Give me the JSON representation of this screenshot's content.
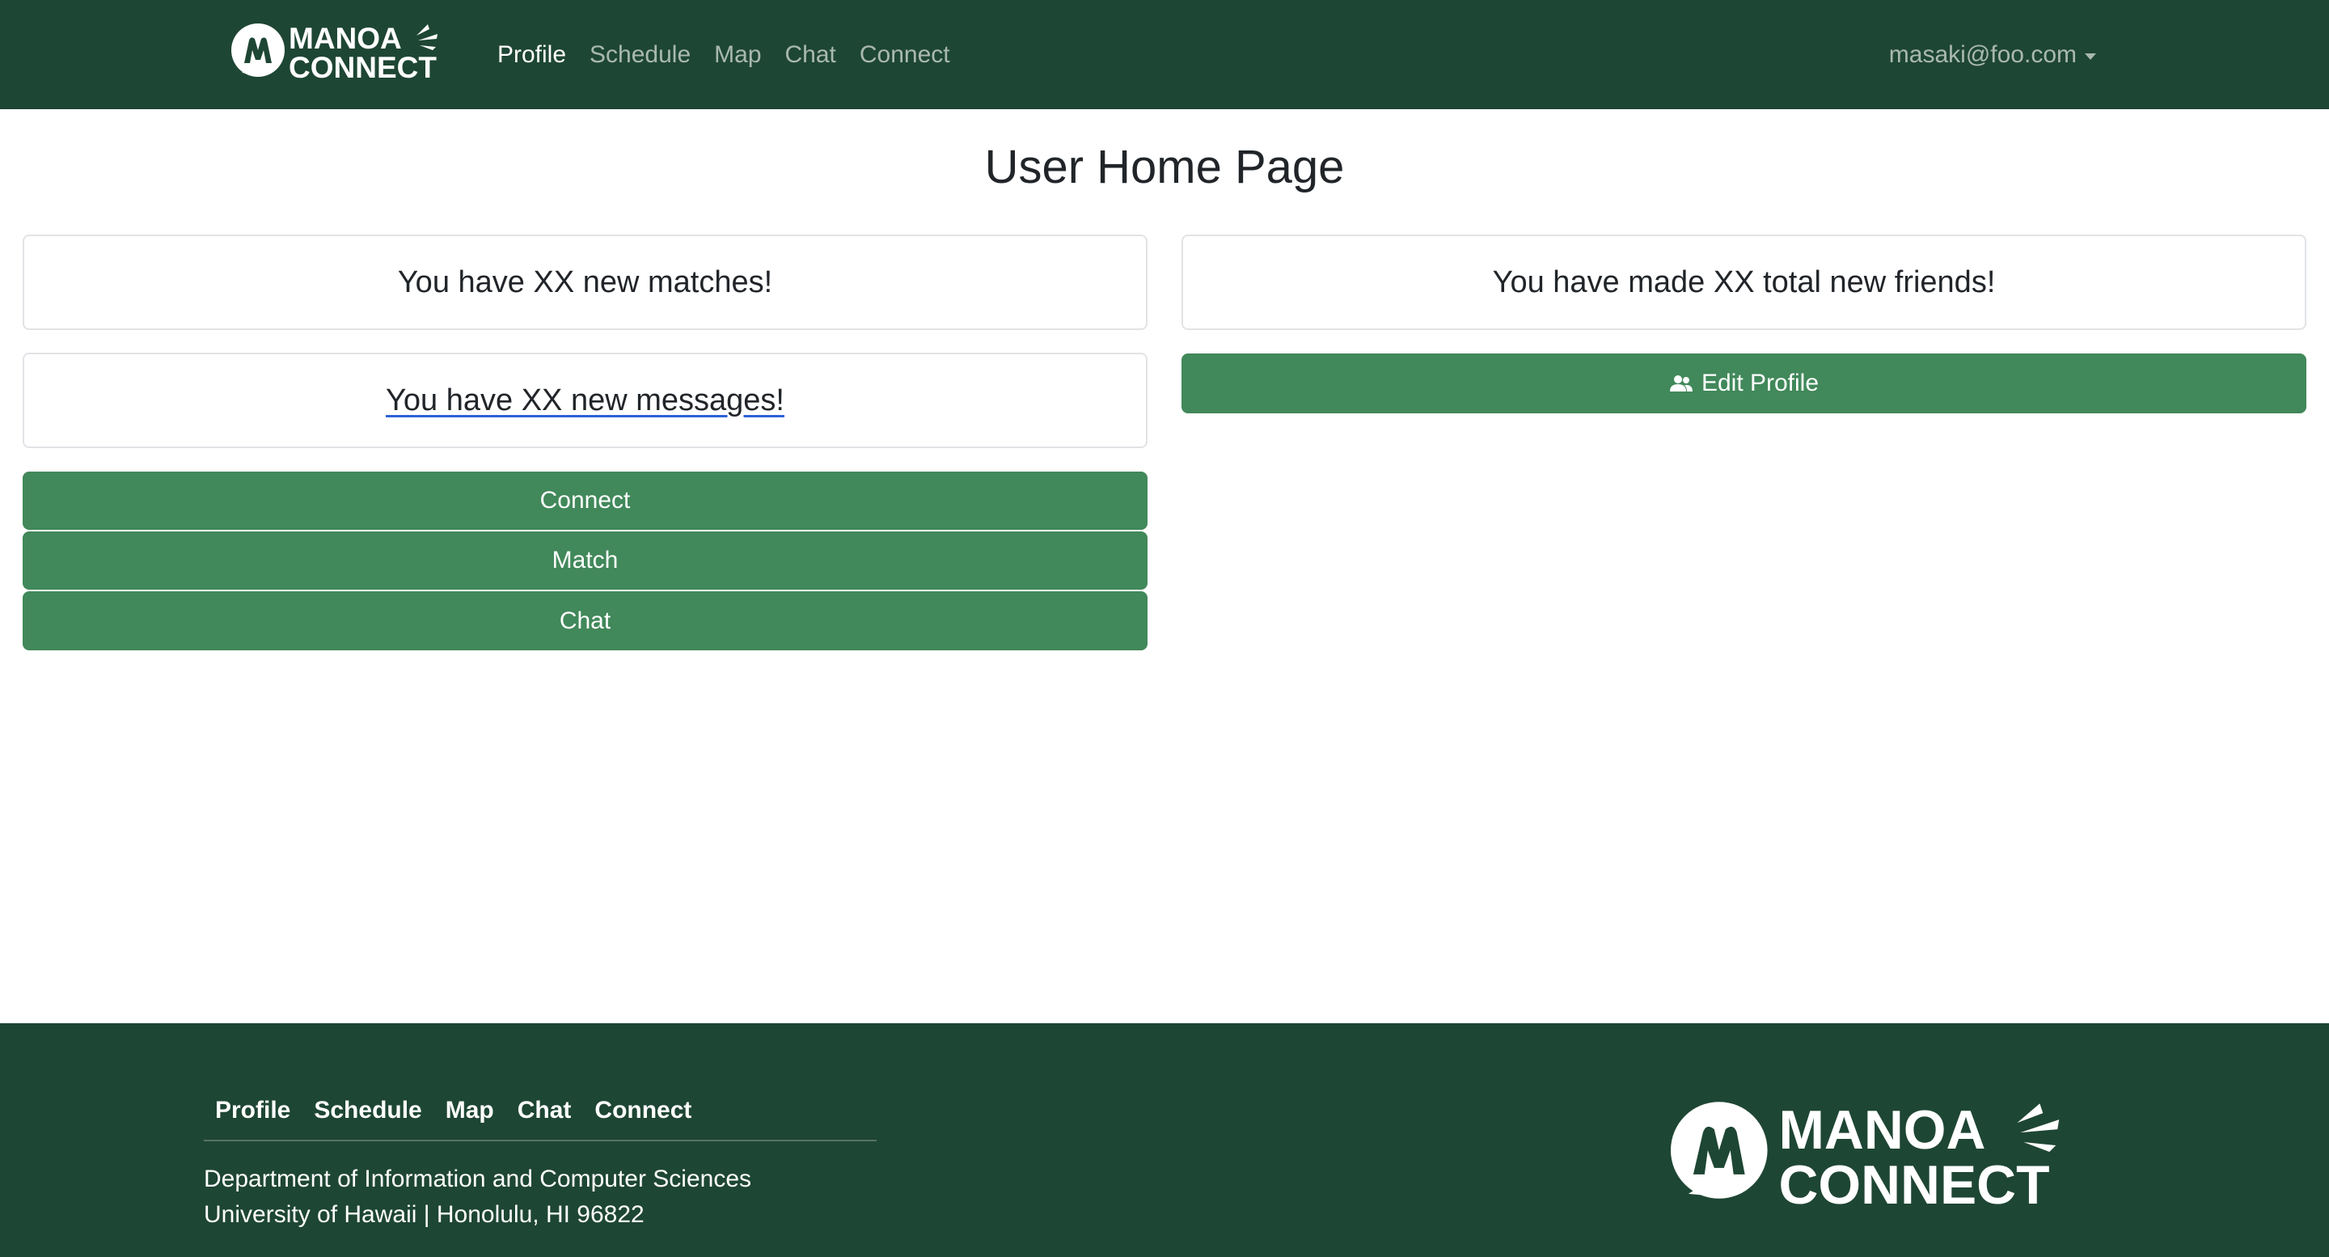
{
  "brand": {
    "logo_line1": "MANOA",
    "logo_line2": "CONNECT",
    "logo_color": "#ffffff"
  },
  "nav": {
    "items": [
      {
        "label": "Profile",
        "active": true
      },
      {
        "label": "Schedule",
        "active": false
      },
      {
        "label": "Map",
        "active": false
      },
      {
        "label": "Chat",
        "active": false
      },
      {
        "label": "Connect",
        "active": false
      }
    ],
    "user": "masaki@foo.com",
    "user_icon": "chevron-down-icon"
  },
  "main": {
    "title": "User Home Page",
    "matches_text": "You have XX new matches!",
    "messages_text": "You have XX new messages!",
    "friends_text": "You have made XX total new friends!",
    "buttons": {
      "connect": "Connect",
      "match": "Match",
      "chat": "Chat",
      "edit_profile": "Edit Profile",
      "edit_profile_icon": "people-icon"
    }
  },
  "footer": {
    "links": [
      "Profile",
      "Schedule",
      "Map",
      "Chat",
      "Connect"
    ],
    "department": "Department of Information and Computer Sciences",
    "address": "University of Hawaii | Honolulu, HI 96822"
  },
  "colors": {
    "navbar_bg": "#1e4634",
    "button_green": "#41885a",
    "footer_bg": "#1e4634"
  }
}
